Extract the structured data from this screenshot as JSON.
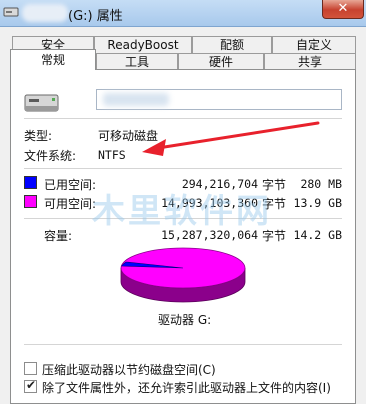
{
  "window": {
    "title": "(G:) 属性",
    "close_glyph": "✕"
  },
  "tabs_row1": [
    {
      "label": "安全"
    },
    {
      "label": "ReadyBoost"
    },
    {
      "label": "配额"
    },
    {
      "label": "自定义"
    }
  ],
  "tabs_row2": [
    {
      "label": "常规",
      "selected": true
    },
    {
      "label": "工具"
    },
    {
      "label": "硬件"
    },
    {
      "label": "共享"
    }
  ],
  "general": {
    "type_label": "类型:",
    "type_value": "可移动磁盘",
    "fs_label": "文件系统:",
    "fs_value": "NTFS"
  },
  "space": {
    "used": {
      "label": "已用空间:",
      "bytes": "294,216,704",
      "unit": "字节",
      "size": "280 MB",
      "color": "#0000ff"
    },
    "free": {
      "label": "可用空间:",
      "bytes": "14,993,103,360",
      "unit": "字节",
      "size": "13.9 GB",
      "color": "#ff00ff"
    },
    "capacity": {
      "label": "容量:",
      "bytes": "15,287,320,064",
      "unit": "字节",
      "size": "14.2 GB"
    }
  },
  "drive_caption": "驱动器 G:",
  "options": {
    "compress": {
      "label": "压缩此驱动器以节约磁盘空间(C)",
      "checked": false
    },
    "index": {
      "label": "除了文件属性外，还允许索引此驱动器上文件的内容(I)",
      "checked": true
    }
  },
  "watermark_text": "木里软件网"
}
